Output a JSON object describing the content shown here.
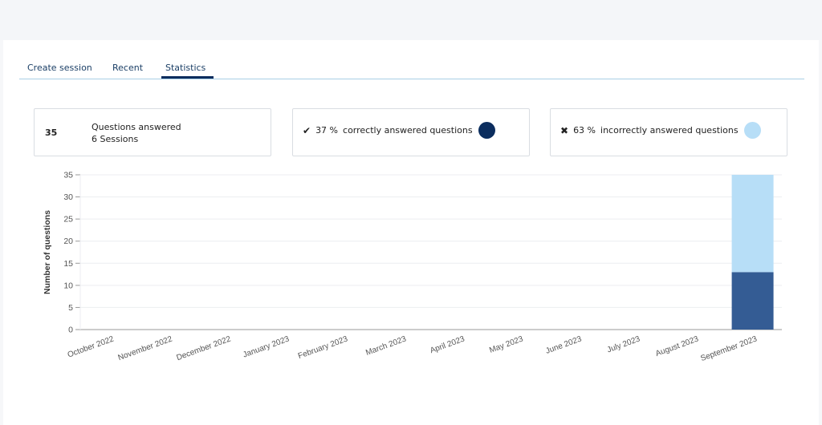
{
  "tabs": [
    {
      "label": "Create session"
    },
    {
      "label": "Recent"
    },
    {
      "label": "Statistics"
    }
  ],
  "summary": {
    "total_questions": "35",
    "questions_label": "Questions answered",
    "sessions_label": "6 Sessions"
  },
  "correct": {
    "icon": "check-icon",
    "icon_glyph": "✔",
    "percent": "37 %",
    "label": "correctly answered questions",
    "color": "#0b2d5e"
  },
  "incorrect": {
    "icon": "cross-icon",
    "icon_glyph": "✖",
    "percent": "63 %",
    "label": "incorrectly answered questions",
    "color": "#b7def7"
  },
  "chart_data": {
    "type": "bar",
    "stacked": true,
    "ylabel": "Number of questions",
    "ylim": [
      0,
      35
    ],
    "yticks": [
      0,
      5,
      10,
      15,
      20,
      25,
      30,
      35
    ],
    "grid": true,
    "categories": [
      "October 2022",
      "November 2022",
      "December 2022",
      "January 2023",
      "February 2023",
      "March 2023",
      "April 2023",
      "May 2023",
      "June 2023",
      "July 2023",
      "August 2023",
      "September 2023"
    ],
    "series": [
      {
        "values": [
          0,
          0,
          0,
          0,
          0,
          0,
          0,
          0,
          0,
          0,
          0,
          13
        ],
        "color": "#345c94"
      },
      {
        "values": [
          0,
          0,
          0,
          0,
          0,
          0,
          0,
          0,
          0,
          0,
          0,
          22
        ],
        "color": "#b7def7"
      }
    ]
  }
}
